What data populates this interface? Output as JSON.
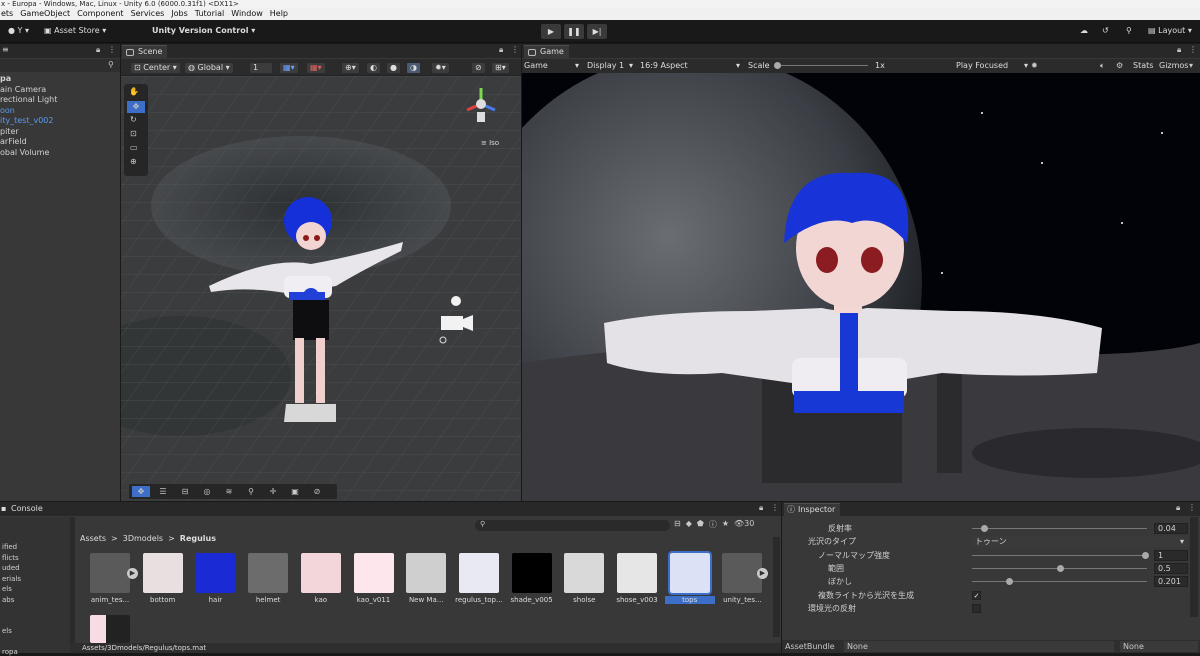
{
  "window": {
    "title": "x - Europa - Windows, Mac, Linux - Unity 6.0 (6000.0.31f1) <DX11>"
  },
  "menu": [
    "ets",
    "GameObject",
    "Component",
    "Services",
    "Jobs",
    "Tutorial",
    "Window",
    "Help"
  ],
  "toolbar": {
    "account": "Y",
    "asset_store": "Asset Store",
    "uvc": "Unity Version Control",
    "layout": "Layout"
  },
  "hierarchy": {
    "items": [
      {
        "label": "pa",
        "selected": false
      },
      {
        "label": "ain Camera",
        "selected": false
      },
      {
        "label": "rectional Light",
        "selected": false
      },
      {
        "label": "oon",
        "selected": true
      },
      {
        "label": "ity_test_v002",
        "selected": true
      },
      {
        "label": "piter",
        "selected": false
      },
      {
        "label": "arField",
        "selected": false
      },
      {
        "label": "obal Volume",
        "selected": false
      }
    ]
  },
  "scene": {
    "tab": "Scene",
    "pivot": "Center",
    "space": "Global",
    "snap": "1",
    "view_label": "Iso"
  },
  "game": {
    "tab": "Game",
    "mode": "Game",
    "display": "Display 1",
    "aspect": "16:9 Aspect",
    "scale_label": "Scale",
    "scale_value": "1x",
    "play_mode": "Play Focused",
    "stats": "Stats",
    "gizmos": "Gizmos"
  },
  "console": {
    "tab": "Console",
    "breadcrumb": [
      "Assets",
      "3Dmodels",
      "Regulus"
    ],
    "hidden_count": "30",
    "path": "Assets/3Dmodels/Regulus/tops.mat",
    "left_items": [
      "ified",
      "flicts",
      "uded",
      "erials",
      "els",
      "abs",
      "",
      "",
      "els",
      "",
      "ropa"
    ],
    "assets": [
      {
        "name": "anim_tes...",
        "color": "#5a5a5a"
      },
      {
        "name": "bottom",
        "color": "#e7dfe0"
      },
      {
        "name": "hair",
        "color": "#1a2bd6"
      },
      {
        "name": "helmet",
        "color": "#6c6c6c"
      },
      {
        "name": "kao",
        "color": "#f3d6da"
      },
      {
        "name": "kao_v011",
        "color": "#fde6ec"
      },
      {
        "name": "New Ma...",
        "color": "#cfcfcf"
      },
      {
        "name": "regulus_top...",
        "color": "#e9e9f3"
      },
      {
        "name": "shade_v005",
        "color": "#000000"
      },
      {
        "name": "sholse",
        "color": "#d9d9d9"
      },
      {
        "name": "shose_v003",
        "color": "#e6e6e6"
      },
      {
        "name": "tops",
        "color": "#dbe2f5"
      },
      {
        "name": "unity_tes...",
        "color": "#5a5a5a"
      }
    ]
  },
  "inspector": {
    "tab": "Inspector",
    "asset_bundle_label": "AssetBundle",
    "asset_bundle_value": "None",
    "asset_bundle_variant": "None",
    "rows": [
      {
        "label": "反射率",
        "indent": 2,
        "value": "0.04",
        "slider": 0.05
      },
      {
        "label": "光沢のタイプ",
        "indent": 0,
        "dropdown": "トゥーン"
      },
      {
        "label": "ノーマルマップ強度",
        "indent": 1,
        "value": "1",
        "slider": 1
      },
      {
        "label": "範囲",
        "indent": 2,
        "value": "0.5",
        "slider": 0.5
      },
      {
        "label": "ぼかし",
        "indent": 2,
        "value": "0.201",
        "slider": 0.2
      },
      {
        "label": "複数ライトから光沢を生成",
        "indent": 1,
        "checkbox": true
      },
      {
        "label": "環境光の反射",
        "indent": 0,
        "checkbox": false
      }
    ]
  },
  "colors": {
    "accent": "#3d6ec8",
    "selected_text": "#5b9bf0",
    "panel": "#383838",
    "toolbar": "#191919"
  }
}
